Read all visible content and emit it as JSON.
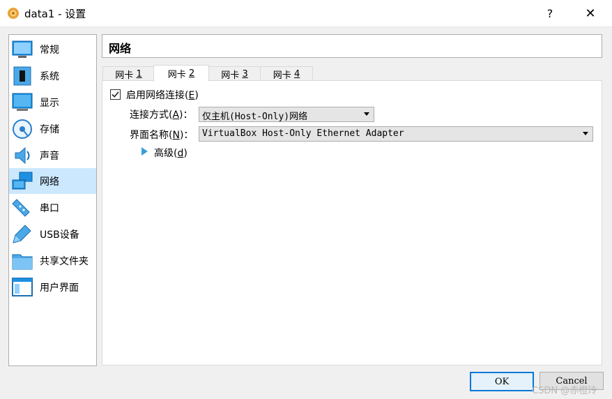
{
  "window": {
    "title": "data1 - 设置",
    "help_label": "?",
    "close_label": "✕"
  },
  "sidebar": {
    "items": [
      {
        "label": "常规",
        "icon": "general-icon"
      },
      {
        "label": "系统",
        "icon": "system-icon"
      },
      {
        "label": "显示",
        "icon": "display-icon"
      },
      {
        "label": "存储",
        "icon": "storage-icon"
      },
      {
        "label": "声音",
        "icon": "audio-icon"
      },
      {
        "label": "网络",
        "icon": "network-icon",
        "selected": true
      },
      {
        "label": "串口",
        "icon": "serial-port-icon"
      },
      {
        "label": "USB设备",
        "icon": "usb-icon"
      },
      {
        "label": "共享文件夹",
        "icon": "shared-folder-icon"
      },
      {
        "label": "用户界面",
        "icon": "user-interface-icon"
      }
    ]
  },
  "page": {
    "title": "网络"
  },
  "tabs": [
    {
      "label": "网卡",
      "number": "1"
    },
    {
      "label": "网卡",
      "number": "2",
      "active": true
    },
    {
      "label": "网卡",
      "number": "3"
    },
    {
      "label": "网卡",
      "number": "4"
    }
  ],
  "adapter": {
    "enable_label": "启用网络连接",
    "enable_mnemonic": "E",
    "enabled": true,
    "attached_label": "连接方式",
    "attached_mnemonic": "A",
    "attached_value": "仅主机(Host-Only)网络",
    "name_label": "界面名称",
    "name_mnemonic": "N",
    "name_value": "VirtualBox Host-Only Ethernet Adapter",
    "advanced_label": "高级",
    "advanced_mnemonic": "d"
  },
  "buttons": {
    "ok": "OK",
    "cancel": "Cancel"
  },
  "watermark": "CSDN @赤橙玲",
  "colors": {
    "selection": "#cce8ff",
    "accent": "#0078d7",
    "arrow": "#3c9dd8"
  }
}
